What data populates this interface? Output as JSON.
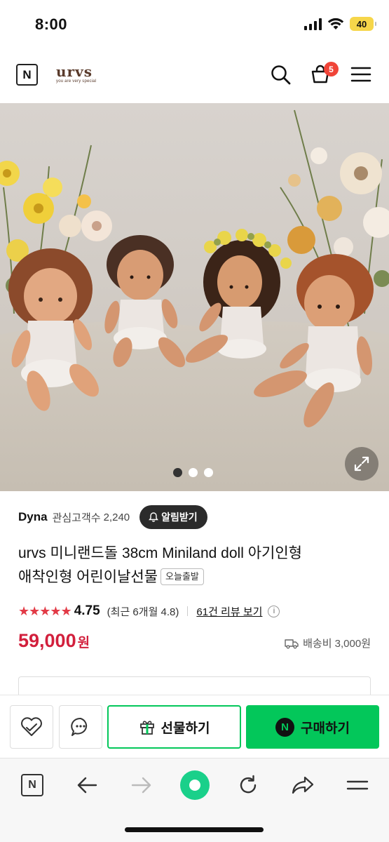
{
  "status": {
    "time": "8:00",
    "battery": "40"
  },
  "header": {
    "logo_letter": "N",
    "brand_name": "urvs",
    "brand_tagline": "you are very special",
    "cart_count": "5"
  },
  "hero": {
    "slide_count": 3,
    "active_slide": 1
  },
  "seller": {
    "name": "Dyna",
    "follower_label": "관심고객수",
    "follower_count": "2,240",
    "alarm_label": "알림받기"
  },
  "product": {
    "title_line1": "urvs 미니랜드돌 38cm Miniland doll 아기인형",
    "title_line2": "애착인형 어린이날선물",
    "badge": "오늘출발",
    "stars": "★★★★★",
    "rating": "4.75",
    "rating_recent": "(최근 6개월 4.8)",
    "review_link": "61건 리뷰 보기",
    "info": "i",
    "price": "59,000",
    "price_unit": "원",
    "shipping": "배송비 3,000원"
  },
  "actions": {
    "gift_label": "선물하기",
    "buy_label": "구매하기",
    "npay_letter": "N"
  },
  "browser": {
    "home_letter": "N"
  },
  "colors": {
    "accent_green": "#03c75a",
    "price_red": "#d21f3c",
    "star_red": "#e23a46",
    "badge_red": "#f04438"
  }
}
